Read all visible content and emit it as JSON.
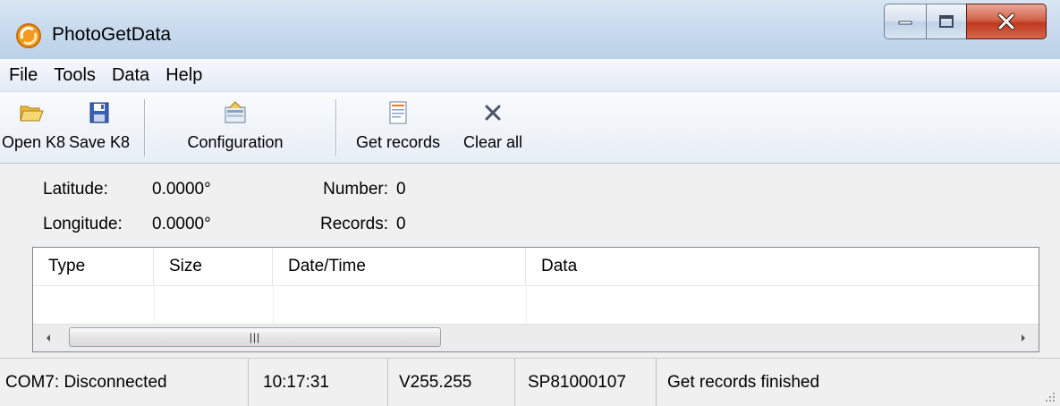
{
  "window": {
    "title": "PhotoGetData",
    "icon": "app-logo-icon"
  },
  "menu": [
    {
      "label": "File"
    },
    {
      "label": "Tools"
    },
    {
      "label": "Data"
    },
    {
      "label": "Help"
    }
  ],
  "toolbar": {
    "open": {
      "label": "Open K8",
      "icon": "folder-open-icon"
    },
    "save": {
      "label": "Save K8",
      "icon": "floppy-disk-icon"
    },
    "config": {
      "label": "Configuration",
      "icon": "configuration-icon"
    },
    "get": {
      "label": "Get records",
      "icon": "document-icon"
    },
    "clear": {
      "label": "Clear all",
      "icon": "x-icon"
    }
  },
  "info": {
    "latitude_label": "Latitude:",
    "latitude_value": "0.0000°",
    "longitude_label": "Longitude:",
    "longitude_value": "0.0000°",
    "number_label": "Number:",
    "number_value": "0",
    "records_label": "Records:",
    "records_value": "0"
  },
  "table": {
    "columns": [
      "Type",
      "Size",
      "Date/Time",
      "Data"
    ],
    "rows": []
  },
  "status": {
    "connection": "COM7: Disconnected",
    "time": "10:17:31",
    "version": "V255.255",
    "serial": "SP81000107",
    "message": "Get records finished"
  },
  "colors": {
    "accent": "#bcd1e8",
    "close_button": "#c0391d"
  }
}
